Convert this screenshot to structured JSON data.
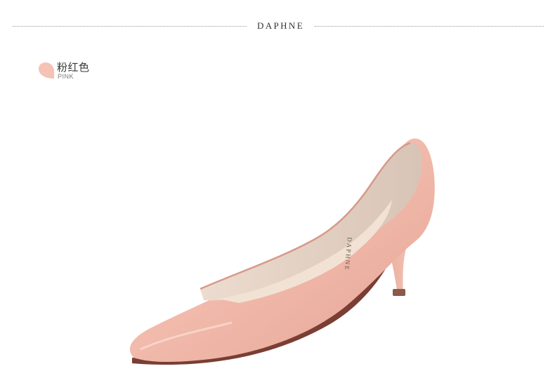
{
  "brand": "DAPHNE",
  "color_variant": {
    "name_cn": "粉红色",
    "name_en": "PINK",
    "swatch_color": "#f4c3b6"
  },
  "product": {
    "insole_print": "DAPHNE",
    "upper_color": "#f0b7a8",
    "lining_color": "#e8d7c8"
  }
}
